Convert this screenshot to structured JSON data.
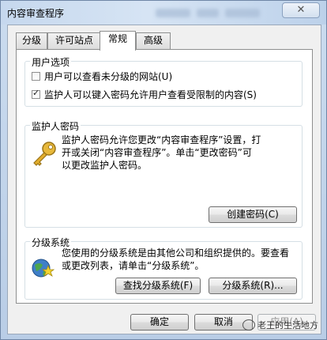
{
  "window": {
    "title": "内容审查程序"
  },
  "tabs": [
    {
      "label": "分级"
    },
    {
      "label": "许可站点"
    },
    {
      "label": "常规",
      "active": true
    },
    {
      "label": "高级"
    }
  ],
  "user_options": {
    "title": "用户选项",
    "option1": {
      "label": "用户可以查看未分级的网站(U)",
      "checked": false
    },
    "option2": {
      "label": "监护人可以键入密码允许用户查看受限制的内容(S)",
      "checked": true
    }
  },
  "supervisor_password": {
    "title": "监护人密码",
    "description_lines": [
      "监护人密码允许您更改“内容审查程序”设置，打",
      "开或关闭“内容审查程序”。单击“更改密码”可",
      "以更改监护人密码。"
    ],
    "button": "创建密码(C)"
  },
  "rating_systems": {
    "title": "分级系统",
    "description_lines": [
      "您使用的分级系统是由其他公司和组织提供的。要查看",
      "或更改列表，请单击“分级系统”。"
    ],
    "find_button": "查找分级系统(F)",
    "systems_button": "分级系统(R)..."
  },
  "footer": {
    "ok": "确定",
    "cancel": "取消",
    "apply": "应用(A)"
  },
  "watermark": "老王的生活地方",
  "icons": {
    "key": "key-icon",
    "rating": "rating-system-icon",
    "close": "close-icon"
  }
}
